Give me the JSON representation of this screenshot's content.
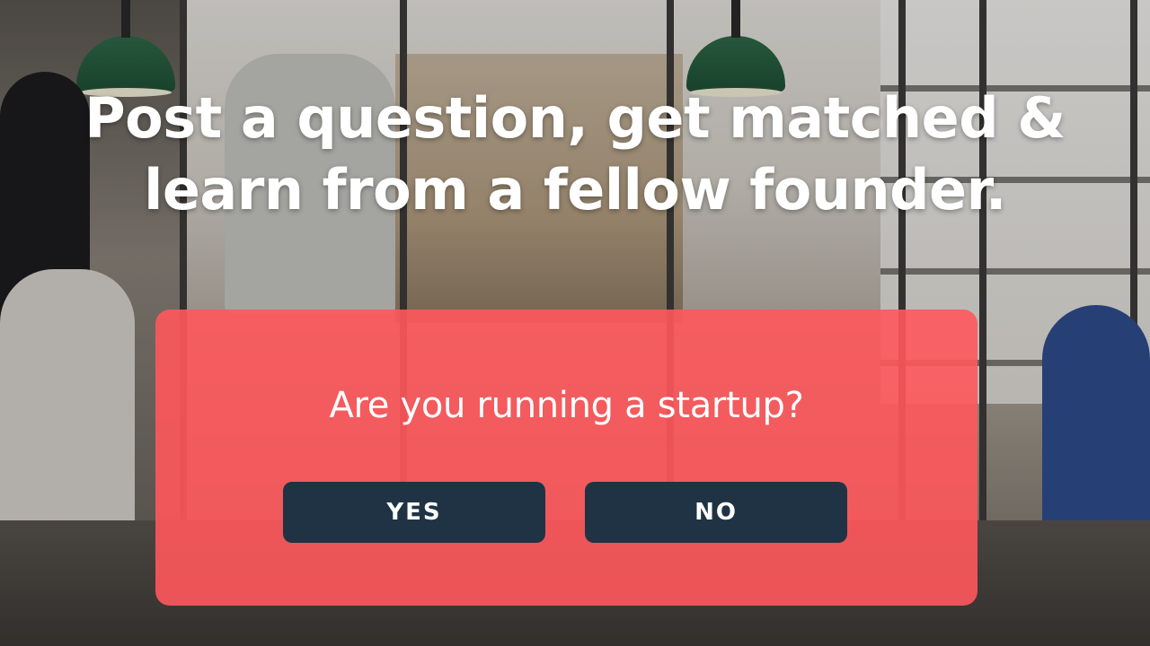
{
  "hero": {
    "headline_line1": "Post a question, get matched &",
    "headline_line2": "learn from a fellow founder."
  },
  "modal": {
    "question": "Are you running a startup?",
    "yes_label": "YES",
    "no_label": "NO"
  },
  "colors": {
    "card": "#ff585c",
    "button": "#1f3345",
    "text": "#ffffff"
  }
}
